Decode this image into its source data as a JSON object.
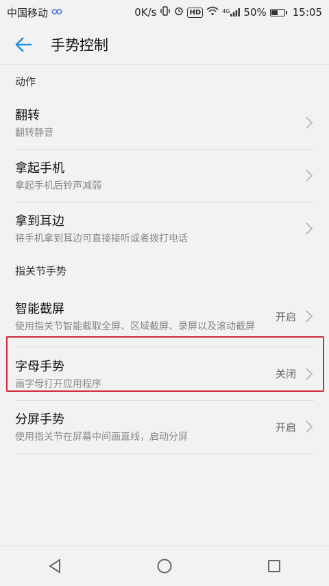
{
  "status_bar": {
    "carrier": "中国移动",
    "speed": "0K/s",
    "network": "4G",
    "battery": "50%",
    "battery_level": 0.5,
    "time": "15:05",
    "hd_label": "HD"
  },
  "app_bar": {
    "title": "手势控制"
  },
  "sections": [
    {
      "header": "动作",
      "items": [
        {
          "label": "翻转",
          "desc": "翻转静音",
          "status": ""
        },
        {
          "label": "拿起手机",
          "desc": "拿起手机后铃声减弱",
          "status": ""
        },
        {
          "label": "拿到耳边",
          "desc": "将手机拿到耳边可直接接听或者拨打电话",
          "status": ""
        }
      ]
    },
    {
      "header": "指关节手势",
      "items": [
        {
          "label": "智能截屏",
          "desc": "使用指关节智能截取全屏、区域截屏、录屏以及滚动截屏",
          "status": "开启"
        },
        {
          "label": "字母手势",
          "desc": "画字母打开应用程序",
          "status": "关闭"
        },
        {
          "label": "分屏手势",
          "desc": "使用指关节在屏幕中间画直线，启动分屏",
          "status": "开启"
        }
      ]
    }
  ],
  "nav_bar": {
    "back_icon": "triangle-back-icon",
    "home_icon": "circle-home-icon",
    "recents_icon": "square-recents-icon"
  },
  "accent_color": "#1a8fe3",
  "highlight_color": "#d0283a"
}
